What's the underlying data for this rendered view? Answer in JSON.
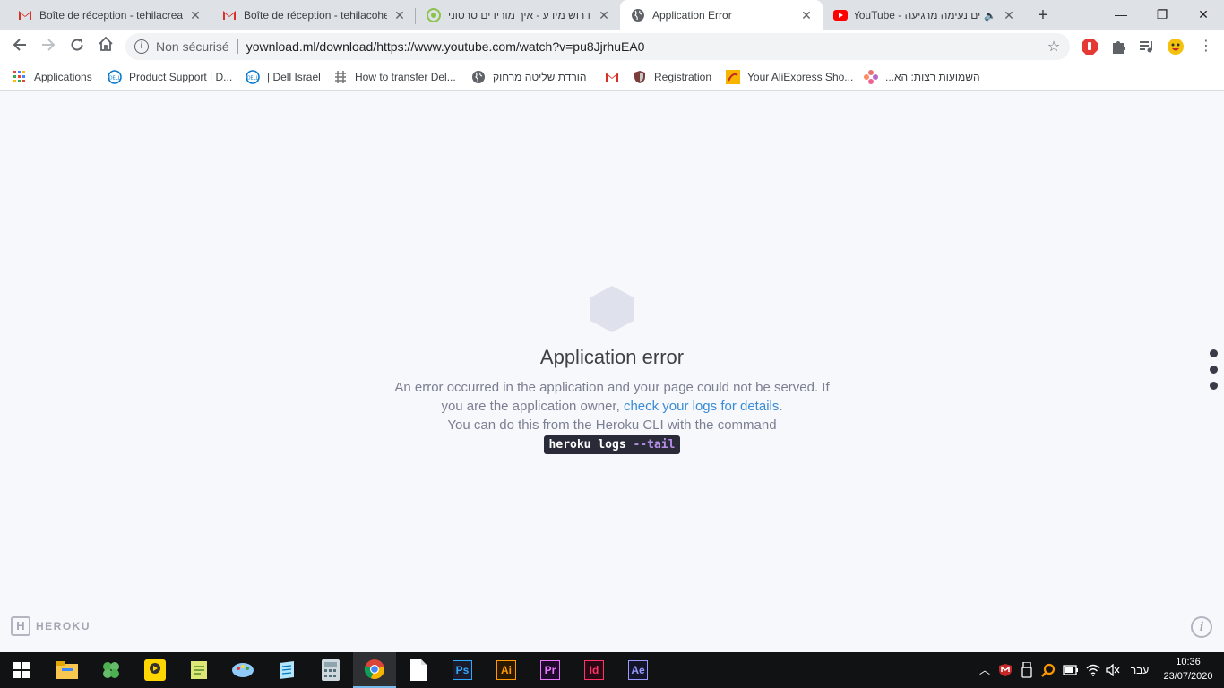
{
  "browser": {
    "tabs": [
      {
        "title": "Boîte de réception - tehilacreat",
        "favicon": "gmail-icon",
        "active": false
      },
      {
        "title": "Boîte de réception - tehilacohe",
        "favicon": "gmail-icon",
        "active": false
      },
      {
        "title": "דרוש מידע - איך מורידים סרטוני",
        "favicon": "forum-icon",
        "active": false
      },
      {
        "title": "Application Error",
        "favicon": "globe-icon",
        "active": true
      },
      {
        "title": "ים נעימה מרגיעה - YouTube",
        "favicon": "youtube-icon",
        "active": false
      }
    ],
    "address": {
      "security_label": "Non sécurisé",
      "url": "yownload.ml/download/https://www.youtube.com/watch?v=pu8JjrhuEA0"
    },
    "bookmarks": [
      {
        "label": "Applications",
        "icon": "apps-grid-icon"
      },
      {
        "label": "Product Support | D...",
        "icon": "dell-icon"
      },
      {
        "label": "| Dell Israel",
        "icon": "dell-icon"
      },
      {
        "label": "How to transfer Del...",
        "icon": "puzzle-grid-icon"
      },
      {
        "label": "הורדת שליטה מרחוק",
        "icon": "globe-icon"
      },
      {
        "label": "",
        "icon": "gmail-icon"
      },
      {
        "label": "Registration",
        "icon": "shield-icon"
      },
      {
        "label": "Your AliExpress Sho...",
        "icon": "aliexpress-icon"
      },
      {
        "label": "השמועות רצות: הא...",
        "icon": "flower-icon"
      }
    ]
  },
  "page": {
    "title": "Application error",
    "message_part1": "An error occurred in the application and your page could not be served. If you are the application owner,",
    "link_text": "check your logs for details",
    "message_part2": "You can do this from the Heroku CLI with the command",
    "command_main": "heroku logs",
    "command_flag": "--tail",
    "logo_text": "HEROKU"
  },
  "taskbar": {
    "language": "עבר",
    "time": "10:36",
    "date": "23/07/2020",
    "apps": [
      "Ps",
      "Ai",
      "Pr",
      "Id",
      "Ae"
    ]
  },
  "colors": {
    "link": "#3a8bd6",
    "photoshop": "#31a8ff",
    "illustrator": "#ff9a00",
    "premiere": "#ea77ff",
    "indesign": "#ff3366",
    "aftereffects": "#9999ff"
  }
}
